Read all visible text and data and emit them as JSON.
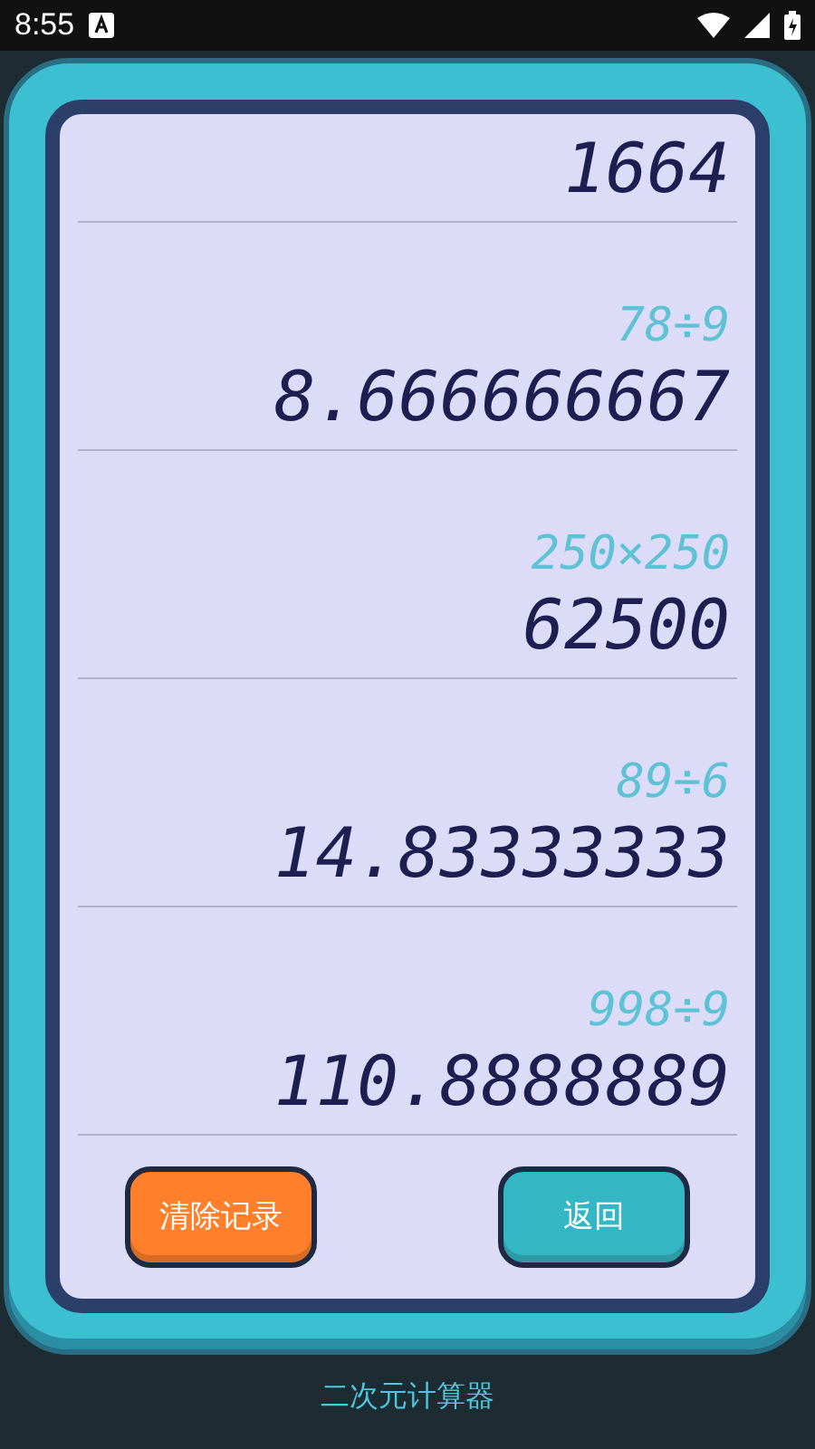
{
  "status_bar": {
    "time": "8:55"
  },
  "history": [
    {
      "result": "1664"
    },
    {
      "expression": "78÷9",
      "result": "8.666666667"
    },
    {
      "expression": "250×250",
      "result": "62500"
    },
    {
      "expression": "89÷6",
      "result": "14.83333333"
    },
    {
      "expression": "998÷9",
      "result": "110.8888889"
    }
  ],
  "buttons": [
    {
      "label": "清除记录",
      "kind": "clear"
    },
    {
      "label": "返回",
      "kind": "back"
    }
  ],
  "footer": {
    "title": "二次元计算器"
  }
}
